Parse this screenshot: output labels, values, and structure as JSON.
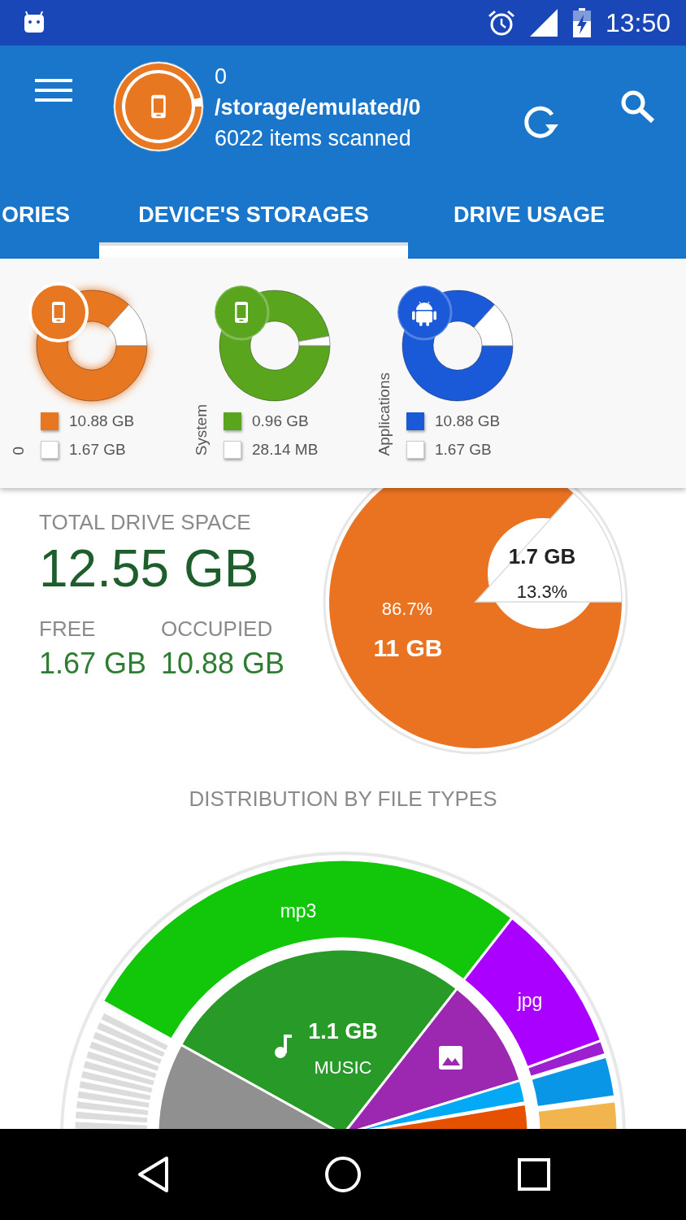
{
  "status_bar": {
    "time": "13:50"
  },
  "header": {
    "count": "0",
    "path": "/storage/emulated/0",
    "scanned": "6022 items scanned"
  },
  "tabs": [
    {
      "label": "ORIES",
      "selected": false
    },
    {
      "label": "DEVICE'S STORAGES",
      "selected": true
    },
    {
      "label": "DRIVE USAGE",
      "selected": false
    }
  ],
  "storages": [
    {
      "label": "0",
      "kind": "device",
      "color": "#e87722",
      "selected": true,
      "chart_data": {
        "type": "donut",
        "values": [
          86.7,
          13.3
        ]
      },
      "legend": [
        {
          "kind": "used",
          "text": "10.88 GB"
        },
        {
          "kind": "free",
          "text": "1.67 GB"
        }
      ]
    },
    {
      "label": "System",
      "kind": "device",
      "color": "#5aa51e",
      "selected": false,
      "chart_data": {
        "type": "donut",
        "values": [
          97.2,
          2.8
        ]
      },
      "legend": [
        {
          "kind": "used",
          "text": "0.96 GB"
        },
        {
          "kind": "free",
          "text": "28.14 MB"
        }
      ]
    },
    {
      "label": "Applications",
      "kind": "apps",
      "color": "#1a5ad8",
      "selected": false,
      "chart_data": {
        "type": "donut",
        "values": [
          86.7,
          13.3
        ]
      },
      "legend": [
        {
          "kind": "used",
          "text": "10.88 GB"
        },
        {
          "kind": "free",
          "text": "1.67 GB"
        }
      ]
    }
  ],
  "drive": {
    "title": "TOTAL DRIVE SPACE",
    "total": "12.55 GB",
    "free_label": "FREE",
    "free": "1.67 GB",
    "occupied_label": "OCCUPIED",
    "occupied": "10.88 GB",
    "chart_data": {
      "type": "pie",
      "values": [
        86.7,
        13.3
      ]
    },
    "occupied_percent": "86.7%",
    "occupied_size": "11 GB",
    "free_size": "1.7 GB",
    "free_percent": "13.3%"
  },
  "distribution": {
    "title": "DISTRIBUTION BY FILE TYPES",
    "outer_labels": [
      "mp3",
      "jpg"
    ],
    "category_size": "1.1 GB",
    "category": "MUSIC"
  }
}
